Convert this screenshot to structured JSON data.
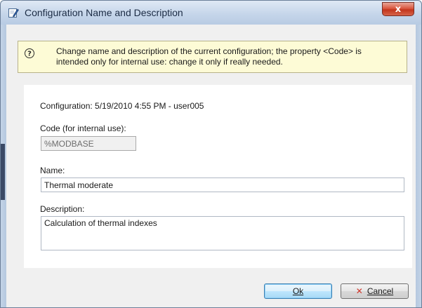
{
  "window": {
    "title": "Configuration Name and Description",
    "close_glyph": "x",
    "title_icon": "edit-icon"
  },
  "info": {
    "icon": "help-icon",
    "message_line1": "Change name and description of the current configuration; the property <Code> is",
    "message_line2": "intended only for internal use: change it only if really needed."
  },
  "form": {
    "configuration_text": "Configuration: 5/19/2010 4:55 PM - user005",
    "code_label": "Code (for internal use):",
    "code_value": "%MODBASE",
    "name_label": "Name:",
    "name_value": "Thermal moderate",
    "description_label": "Description:",
    "description_value": "Calculation of thermal indexes"
  },
  "buttons": {
    "ok_label": "Ok",
    "cancel_label": "Cancel",
    "cancel_icon": "x-icon"
  },
  "colors": {
    "info_background": "#fdfbd6",
    "close_button": "#c2351c",
    "default_button_border": "#3c7fb1"
  }
}
